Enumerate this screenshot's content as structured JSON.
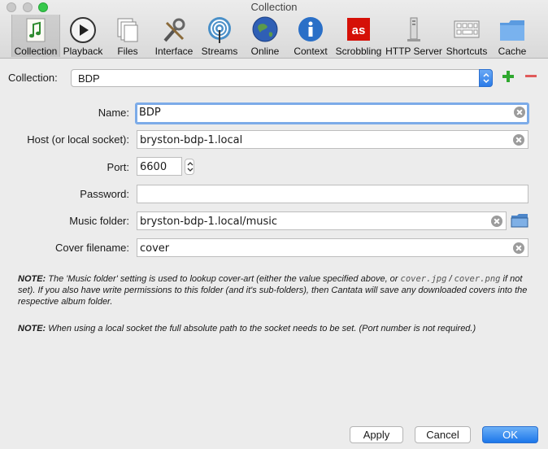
{
  "window": {
    "title": "Collection"
  },
  "toolbar": {
    "tabs": [
      {
        "label": "Collection",
        "icon": "music-note-document-icon",
        "selected": true
      },
      {
        "label": "Playback",
        "icon": "play-circle-icon"
      },
      {
        "label": "Files",
        "icon": "files-icon"
      },
      {
        "label": "Interface",
        "icon": "tools-icon"
      },
      {
        "label": "Streams",
        "icon": "antenna-icon"
      },
      {
        "label": "Online",
        "icon": "globe-icon"
      },
      {
        "label": "Context",
        "icon": "info-icon"
      },
      {
        "label": "Scrobbling",
        "icon": "lastfm-icon"
      },
      {
        "label": "HTTP Server",
        "icon": "server-icon"
      },
      {
        "label": "Shortcuts",
        "icon": "keyboard-icon"
      },
      {
        "label": "Cache",
        "icon": "folder-icon"
      }
    ]
  },
  "collection": {
    "label": "Collection:",
    "selected": "BDP"
  },
  "form": {
    "name": {
      "label": "Name:",
      "value": "BDP"
    },
    "host": {
      "label": "Host (or local socket):",
      "value": "bryston-bdp-1.local"
    },
    "port": {
      "label": "Port:",
      "value": "6600"
    },
    "password": {
      "label": "Password:",
      "value": ""
    },
    "music_folder": {
      "label": "Music folder:",
      "value": "bryston-bdp-1.local/music"
    },
    "cover_filename": {
      "label": "Cover filename:",
      "value": "cover"
    }
  },
  "notes": {
    "note1": {
      "prefix": "NOTE:",
      "text_a": " The 'Music folder' setting is used to lookup cover-art (either the value specified above, or ",
      "code_a": "cover.jpg",
      "text_b": " / ",
      "code_b": "cover.png",
      "text_c": " if not set). If you also have write permissions to this folder (and it's sub-folders), then Cantata will save any downloaded covers into the respective album folder."
    },
    "note2": {
      "prefix": "NOTE:",
      "text": " When using a local socket the full absolute path to the socket needs to be set. (Port number is not required.)"
    }
  },
  "buttons": {
    "apply": "Apply",
    "cancel": "Cancel",
    "ok": "OK"
  },
  "colors": {
    "accent": "#2a7be8",
    "add": "#2fa82f",
    "remove": "#e05a5a"
  }
}
